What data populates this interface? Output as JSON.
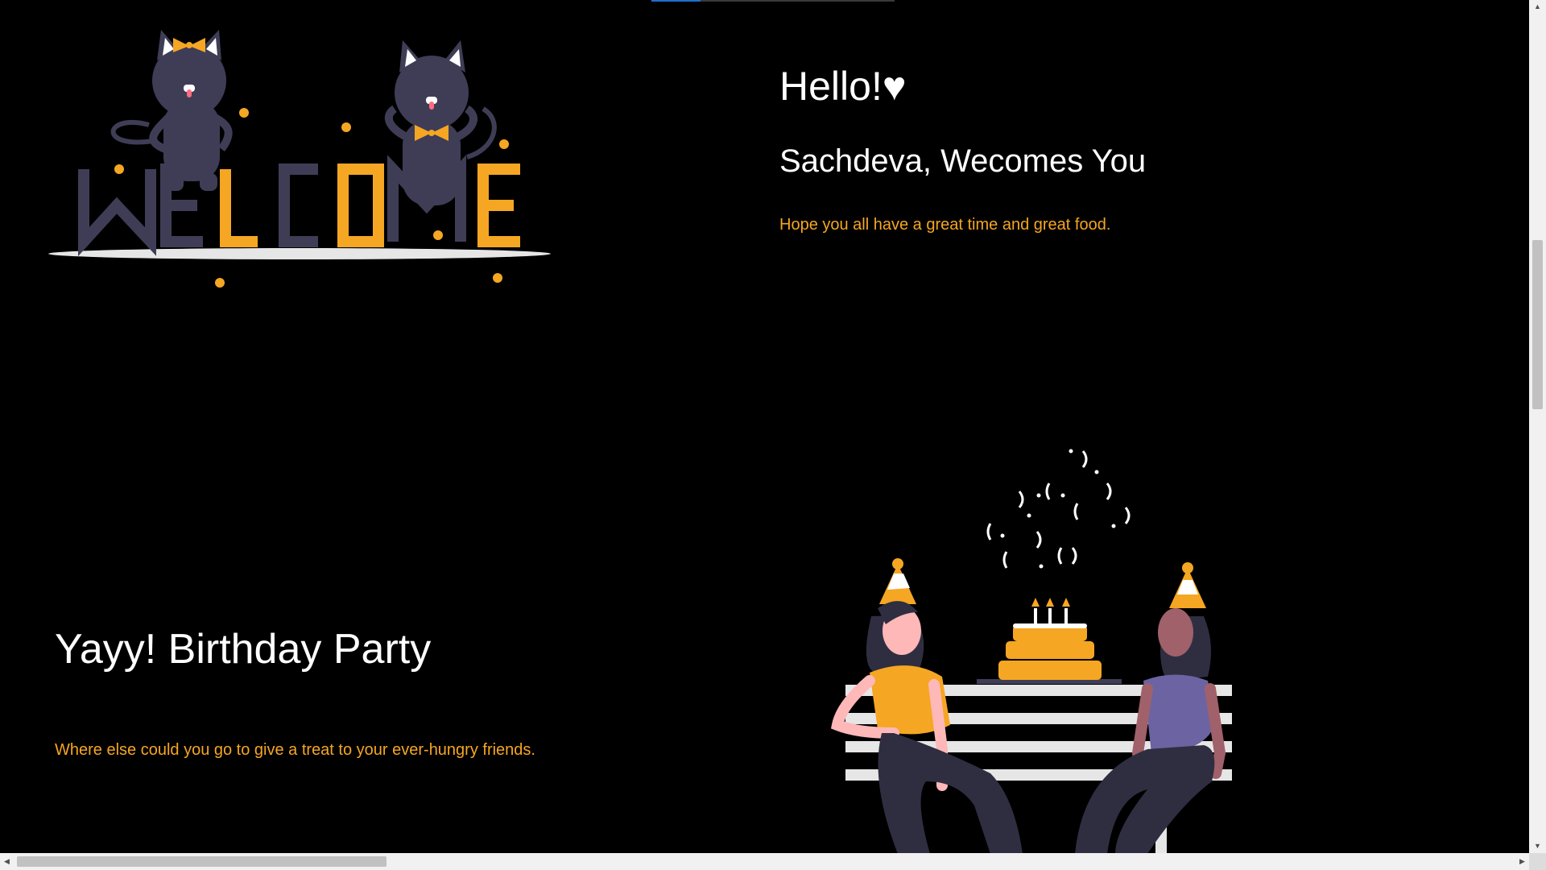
{
  "hero": {
    "title": "Hello!♥",
    "subtitle": "Sachdeva, Wecomes You",
    "tagline": "Hope you all have a great time and great food.",
    "illustration_word": "WELCOME"
  },
  "party": {
    "title": "Yayy! Birthday Party",
    "description": "Where else could you go to give a treat to your ever-hungry friends."
  },
  "colors": {
    "background": "#000000",
    "accent": "#f5a623",
    "dark_figure": "#3f3d56",
    "text": "#ffffff"
  },
  "icons": {
    "scroll_up": "▲",
    "scroll_down": "▼",
    "scroll_left": "◀",
    "scroll_right": "▶"
  }
}
